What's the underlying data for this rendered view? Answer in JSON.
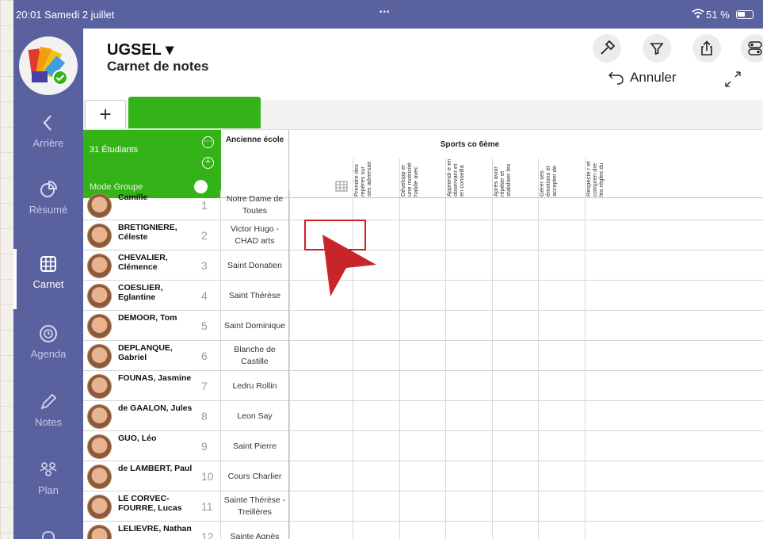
{
  "status_bar": {
    "time": "20:01  Samedi 2 juillet",
    "dots": "•••",
    "battery": "51 %"
  },
  "sidebar": {
    "items": [
      {
        "label": "Arrière",
        "icon": "chevron-left-icon"
      },
      {
        "label": "Résumé",
        "icon": "pie-chart-icon"
      },
      {
        "label": "Carnet",
        "icon": "grid-icon"
      },
      {
        "label": "Agenda",
        "icon": "clock-icon"
      },
      {
        "label": "Notes",
        "icon": "pencil-icon"
      },
      {
        "label": "Plan",
        "icon": "people-icon"
      }
    ]
  },
  "header": {
    "title": "UGSEL ▾",
    "subtitle": "Carnet de notes",
    "undo_label": "Annuler"
  },
  "tabs": {
    "add_label": "+"
  },
  "grid": {
    "student_count": "31 Étudiants",
    "group_mode_label": "Mode Groupe",
    "school_header": "Ancienne école",
    "sports_header": "Sports co 6ème",
    "skill_columns": [
      "Prendre des repères sur ses adversair",
      "Développ er une motricité habile avec",
      "Apprendr e en observant et en conseilla",
      "Après avoir répéter et stabiliser les",
      "Gérer ses émotions et accepter de",
      "Respecte r et compren dre les règles du"
    ],
    "rows": [
      {
        "name": "Camille",
        "num": "1",
        "school": "Notre Dame de Toutes"
      },
      {
        "name": "BRETIGNIERE, Céleste",
        "num": "2",
        "school": "Victor Hugo - CHAD arts"
      },
      {
        "name": "CHEVALIER, Clémence",
        "num": "3",
        "school": "Saint Donatien"
      },
      {
        "name": "COESLIER, Eglantine",
        "num": "4",
        "school": "Saint Thérèse"
      },
      {
        "name": "DEMOOR, Tom",
        "num": "5",
        "school": "Saint Dominique"
      },
      {
        "name": "DEPLANQUE, Gabriel",
        "num": "6",
        "school": "Blanche de Castille"
      },
      {
        "name": "FOUNAS, Jasmine",
        "num": "7",
        "school": "Ledru Rollin"
      },
      {
        "name": "de GAALON, Jules",
        "num": "8",
        "school": "Leon Say"
      },
      {
        "name": "GUO, Léo",
        "num": "9",
        "school": "Saint Pierre"
      },
      {
        "name": "de LAMBERT, Paul",
        "num": "10",
        "school": "Cours Charlier"
      },
      {
        "name": "LE CORVEC-FOURRE, Lucas",
        "num": "11",
        "school": "Sainte Thérèse - Treillères"
      },
      {
        "name": "LELIEVRE, Nathan",
        "num": "12",
        "school": "Sainte Agnès"
      }
    ]
  },
  "colors": {
    "sidebar": "#5a619f",
    "accent_green": "#34b318",
    "highlight_red": "#cf1d22"
  }
}
